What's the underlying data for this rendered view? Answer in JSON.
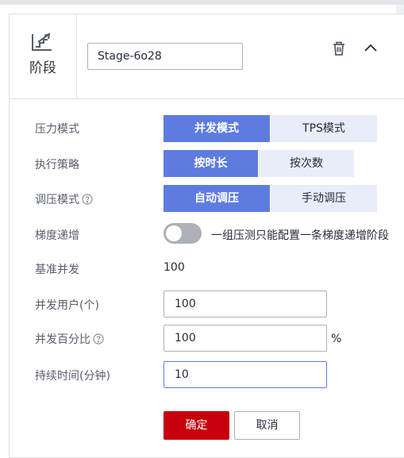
{
  "stage": {
    "icon": "chart-steps-icon",
    "label": "阶段",
    "name_value": "Stage-6o28",
    "delete_icon": "trash-icon",
    "collapse_icon": "chevron-up-icon"
  },
  "pressure_mode": {
    "label": "压力模式",
    "options": [
      "并发模式",
      "TPS模式"
    ],
    "selected": "并发模式"
  },
  "exec_strategy": {
    "label": "执行策略",
    "options": [
      "按时长",
      "按次数"
    ],
    "selected": "按时长"
  },
  "ramp_mode": {
    "label": "调压模式",
    "help_icon": "help-circle-icon",
    "options": [
      "自动调压",
      "手动调压"
    ],
    "selected": "自动调压"
  },
  "gradient": {
    "label": "梯度递增",
    "enabled": false,
    "hint": "一组压测只能配置一条梯度递增阶段"
  },
  "baseline": {
    "label": "基准并发",
    "value": "100"
  },
  "concurrent_users": {
    "label": "并发用户(个)",
    "value": "100"
  },
  "concurrent_percent": {
    "label": "并发百分比",
    "help_icon": "help-circle-icon",
    "value": "100",
    "unit": "%"
  },
  "duration": {
    "label": "持续时间(分钟)",
    "value": "10"
  },
  "actions": {
    "confirm": "确定",
    "cancel": "取消"
  },
  "colors": {
    "accent": "#5e7ce0",
    "accent_light": "#e9edfa",
    "danger": "#c7000b"
  }
}
